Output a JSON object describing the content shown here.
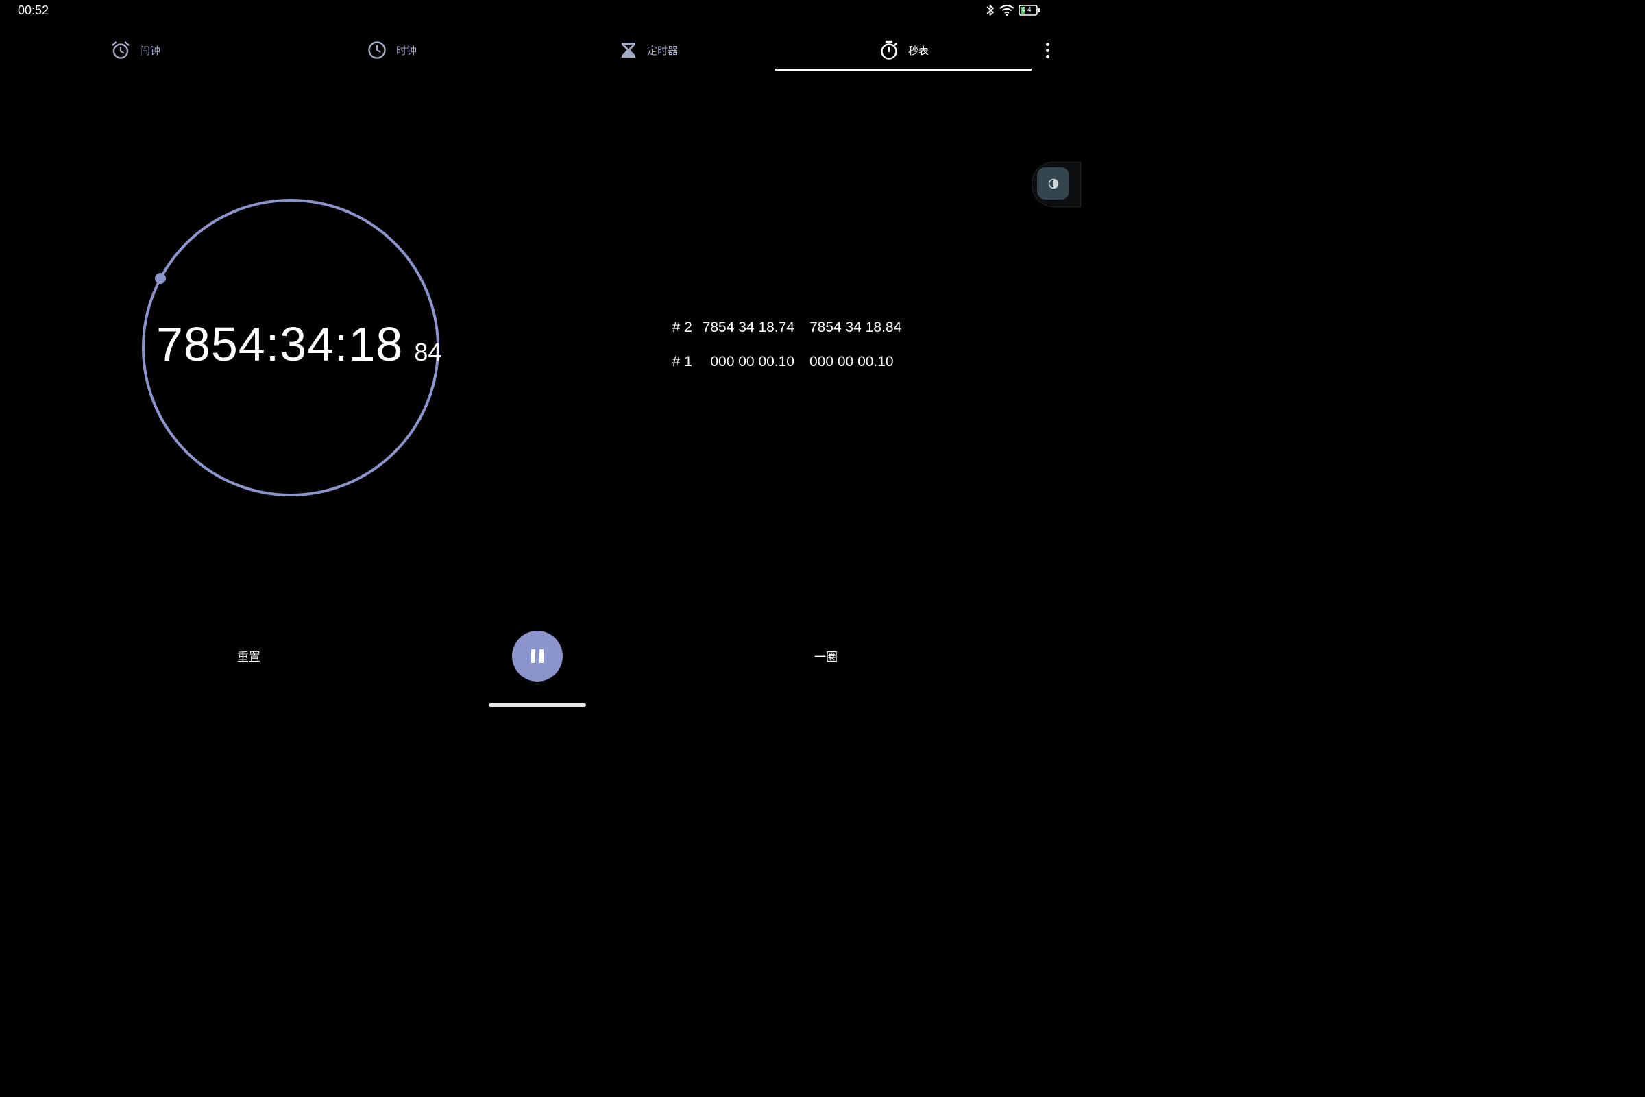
{
  "status_bar": {
    "time": "00:52",
    "battery_level": "4",
    "icons": [
      "bluetooth-icon",
      "wifi-icon",
      "battery-charging-icon"
    ]
  },
  "tabs": [
    {
      "label": "闹钟",
      "icon": "alarm-icon",
      "active": false
    },
    {
      "label": "时钟",
      "icon": "clock-icon",
      "active": false
    },
    {
      "label": "定时器",
      "icon": "hourglass-icon",
      "active": false
    },
    {
      "label": "秒表",
      "icon": "stopwatch-icon",
      "active": true
    }
  ],
  "stopwatch": {
    "time_main": "7854:34:18",
    "time_hundredths": "84"
  },
  "laps": [
    {
      "number": "# 2",
      "lap_time": "7854 34 18.74",
      "total_time": "7854 34 18.84"
    },
    {
      "number": "# 1",
      "lap_time": "000 00 00.10",
      "total_time": "000 00 00.10"
    }
  ],
  "controls": {
    "reset_label": "重置",
    "lap_label": "一圈"
  },
  "colors": {
    "accent": "#8b95cb",
    "background": "#000000",
    "inactive_tab": "#a3a8c4"
  }
}
